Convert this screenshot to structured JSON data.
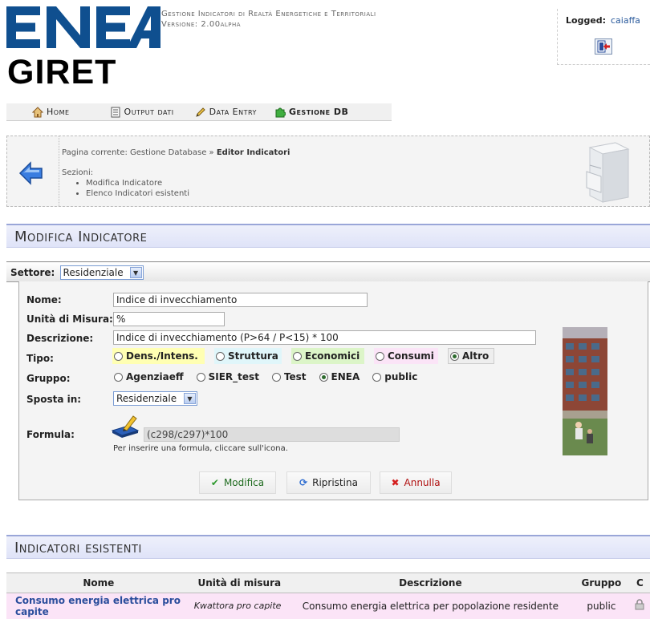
{
  "header": {
    "logo_text": "ENEA",
    "app_name": "GIRET",
    "app_title": "Gestione Indicatori di Realtà Energetiche e Territoriali",
    "version": "Versione: 2.00alpha",
    "logged_label": "Logged:",
    "logged_user": "caiaffa"
  },
  "nav": {
    "home": "Home",
    "output": "Output dati",
    "data_entry": "Data Entry",
    "gestione_db": "Gestione DB"
  },
  "breadcrumb": {
    "prefix": "Pagina corrente: Gestione Database",
    "sep": " » ",
    "current": "Editor Indicatori",
    "sections_label": "Sezioni:",
    "sections": [
      "Modifica Indicatore",
      "Elenco Indicatori esistenti"
    ]
  },
  "modifica": {
    "title": "Modifica Indicatore",
    "settore_label": "Settore:",
    "settore_value": "Residenziale",
    "nome_label": "Nome:",
    "nome_value": "Indice di invecchiamento",
    "unita_label": "Unità di Misura:",
    "unita_value": "%",
    "descrizione_label": "Descrizione:",
    "descrizione_value": "Indice di invecchiamento (P>64 / P<15) * 100",
    "tipo_label": "Tipo:",
    "tipo_options": [
      {
        "label": "Dens./Intens.",
        "color": "#ffffb3",
        "checked": false
      },
      {
        "label": "Struttura",
        "color": "#e0f6fa",
        "checked": false
      },
      {
        "label": "Economici",
        "color": "#dcf5c8",
        "checked": false
      },
      {
        "label": "Consumi",
        "color": "#fbe4f7",
        "checked": false
      },
      {
        "label": "Altro",
        "color": "#eeeeee",
        "checked": true
      }
    ],
    "gruppo_label": "Gruppo:",
    "gruppo_options": [
      {
        "label": "Agenziaeff",
        "checked": false
      },
      {
        "label": "SIER_test",
        "checked": false
      },
      {
        "label": "Test",
        "checked": false
      },
      {
        "label": "ENEA",
        "checked": true
      },
      {
        "label": "public",
        "checked": false
      }
    ],
    "sposta_label": "Sposta in:",
    "sposta_value": "Residenziale",
    "formula_label": "Formula:",
    "formula_value": "(c298/c297)*100",
    "formula_hint": "Per inserire una formula, cliccare sull'icona.",
    "btn_modifica": "Modifica",
    "btn_ripristina": "Ripristina",
    "btn_annulla": "Annulla"
  },
  "esistenti": {
    "title": "Indicatori esistenti",
    "columns": [
      "Nome",
      "Unità di misura",
      "Descrizione",
      "Gruppo",
      "C"
    ],
    "rows": [
      {
        "nome": "Consumo energia elettrica pro capite",
        "unita": "Kwattora pro capite",
        "descrizione": "Consumo energia elettrica per popolazione residente",
        "gruppo": "public"
      }
    ]
  },
  "colors": {
    "enea_blue": "#0f4f8f",
    "link_blue": "#2a4d9c",
    "section_band": "#dfe3f8",
    "row_pink": "#fbe4f7"
  }
}
